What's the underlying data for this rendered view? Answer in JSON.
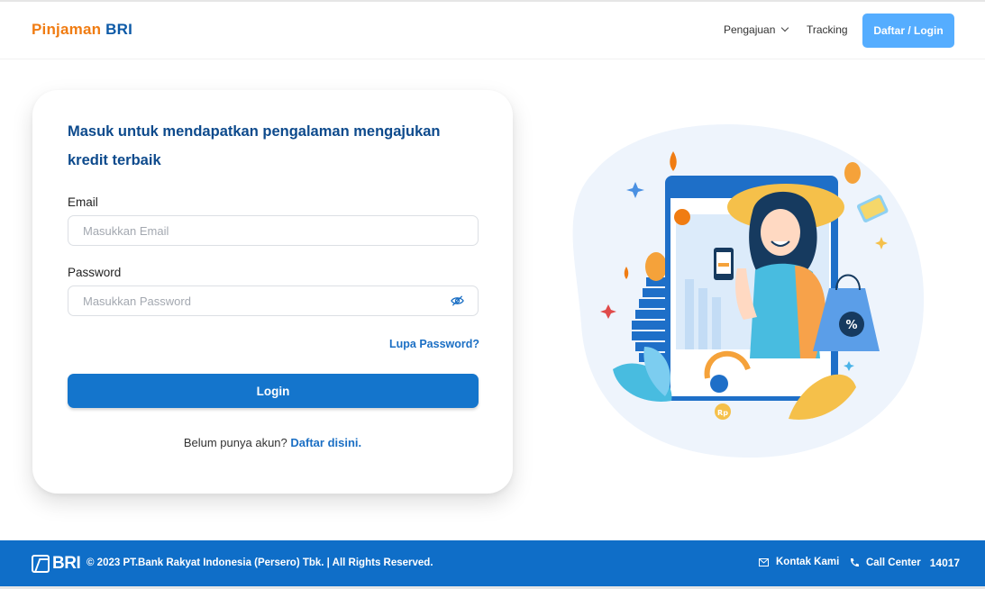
{
  "header": {
    "brand_part1": "Pinjaman",
    "brand_part2": "BRI",
    "nav": {
      "apply_label": "Pengajuan",
      "tracking_label": "Tracking"
    },
    "auth_button_label": "Daftar / Login"
  },
  "login_card": {
    "heading": "Masuk untuk mendapatkan pengalaman mengajukan kredit terbaik",
    "email_label": "Email",
    "email_placeholder": "Masukkan Email",
    "email_value": "",
    "password_label": "Password",
    "password_placeholder": "Masukkan Password",
    "password_value": "",
    "password_toggle_icon": "eye-slash-icon",
    "forgot_link": "Lupa Password?",
    "login_button": "Login",
    "signup_prompt": "Belum punya akun?",
    "signup_link": "Daftar disini."
  },
  "footer": {
    "logo_text": "BRI",
    "copyright": "© 2023 PT.Bank Rakyat Indonesia (Persero) Tbk. | All Rights Reserved.",
    "contact_icon": "envelope-icon",
    "contact_label": "Kontak Kami",
    "call_icon": "phone-icon",
    "call_label": "Call Center",
    "call_number": "14017"
  },
  "illustration": {
    "badge_text": "%",
    "coin_text": "Rp"
  },
  "colors": {
    "brand_orange": "#f07c12",
    "brand_blue": "#0d5aa7",
    "primary_button": "#1475cc",
    "top_button": "#55adff",
    "footer_bg": "#0f6ec8",
    "link": "#1b6fc4"
  }
}
